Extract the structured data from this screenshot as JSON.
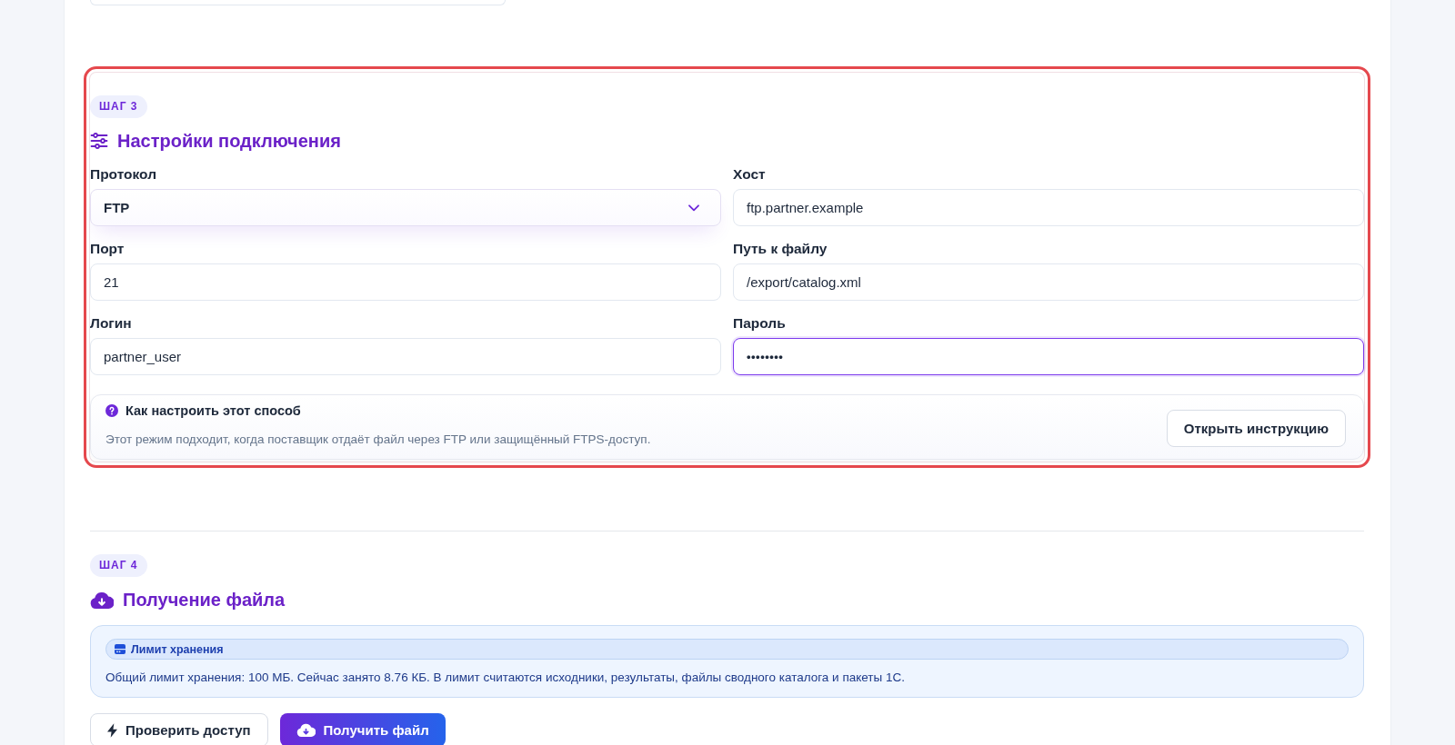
{
  "previous_step": {
    "fields": [
      {
        "kind": "text"
      }
    ]
  },
  "steps": [
    {
      "kind": "settings",
      "highlighted": true,
      "badge": "ШАГ 3",
      "title": "Настройки подключения",
      "fields": [
        {
          "label": "Протокол",
          "kind": "select",
          "value": "FTP",
          "focused": false
        },
        {
          "label": "Хост",
          "kind": "text",
          "value": "ftp.partner.example",
          "focused": false
        },
        {
          "label": "Порт",
          "kind": "text",
          "value": "21",
          "focused": false
        },
        {
          "label": "Путь к файлу",
          "kind": "text",
          "value": "/export/catalog.xml",
          "focused": false
        },
        {
          "label": "Логин",
          "kind": "text",
          "value": "partner_user",
          "focused": false
        },
        {
          "label": "Пароль",
          "kind": "password",
          "value": "••••••••",
          "focused": true
        }
      ],
      "help": {
        "title": "Как настроить этот способ",
        "text": "Этот режим подходит, когда поставщик отдаёт файл через FTP или защищённый FTPS-доступ.",
        "button": "Открыть инструкцию"
      }
    },
    {
      "kind": "fetch",
      "highlighted": false,
      "badge": "ШАГ 4",
      "title": "Получение файла",
      "notice": {
        "title": "Лимит хранения",
        "text": "Общий лимит хранения: 100 МБ. Сейчас занято 8.76 КБ. В лимит считаются исходники, результаты, файлы сводного каталога и пакеты 1С."
      },
      "buttons": [
        {
          "label": "Проверить доступ",
          "kind": "check"
        },
        {
          "label": "Получить файл",
          "kind": "download"
        }
      ]
    }
  ]
}
